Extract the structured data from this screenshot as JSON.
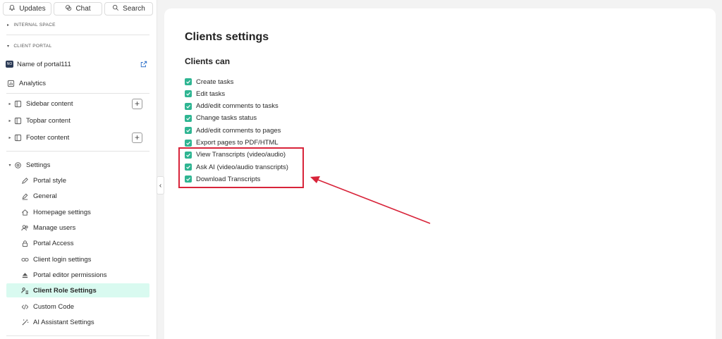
{
  "sidebar": {
    "top_buttons": {
      "updates": "Updates",
      "chat": "Chat",
      "search": "Search"
    },
    "internal_space": "INTERNAL SPACE",
    "client_portal": "CLIENT PORTAL",
    "portal_badge": "NO",
    "portal_name": "Name of portal111",
    "analytics": "Analytics",
    "sidebar_content": "Sidebar content",
    "topbar_content": "Topbar content",
    "footer_content": "Footer content",
    "settings": "Settings",
    "settings_items": [
      {
        "label": "Portal style"
      },
      {
        "label": "General"
      },
      {
        "label": "Homepage settings"
      },
      {
        "label": "Manage users"
      },
      {
        "label": "Portal Access"
      },
      {
        "label": "Client login settings"
      },
      {
        "label": "Portal editor permissions"
      },
      {
        "label": "Client Role Settings"
      },
      {
        "label": "Custom Code"
      },
      {
        "label": "AI Assistant Settings"
      }
    ],
    "plus_label": "+",
    "collapse_glyph": "‹"
  },
  "main": {
    "title": "Clients settings",
    "section_title": "Clients can",
    "permissions": [
      {
        "label": "Create tasks",
        "checked": true
      },
      {
        "label": "Edit tasks",
        "checked": true
      },
      {
        "label": "Add/edit comments to tasks",
        "checked": true
      },
      {
        "label": "Change tasks status",
        "checked": true
      },
      {
        "label": "Add/edit comments to pages",
        "checked": true
      },
      {
        "label": "Export pages to PDF/HTML",
        "checked": true
      },
      {
        "label": "View Transcripts (video/audio)",
        "checked": true
      },
      {
        "label": "Ask AI (video/audio transcripts)",
        "checked": true
      },
      {
        "label": "Download Transcripts",
        "checked": true
      }
    ]
  },
  "colors": {
    "accent": "#2fb592",
    "active_bg": "#d9faf0",
    "annotation": "#d8243a"
  }
}
